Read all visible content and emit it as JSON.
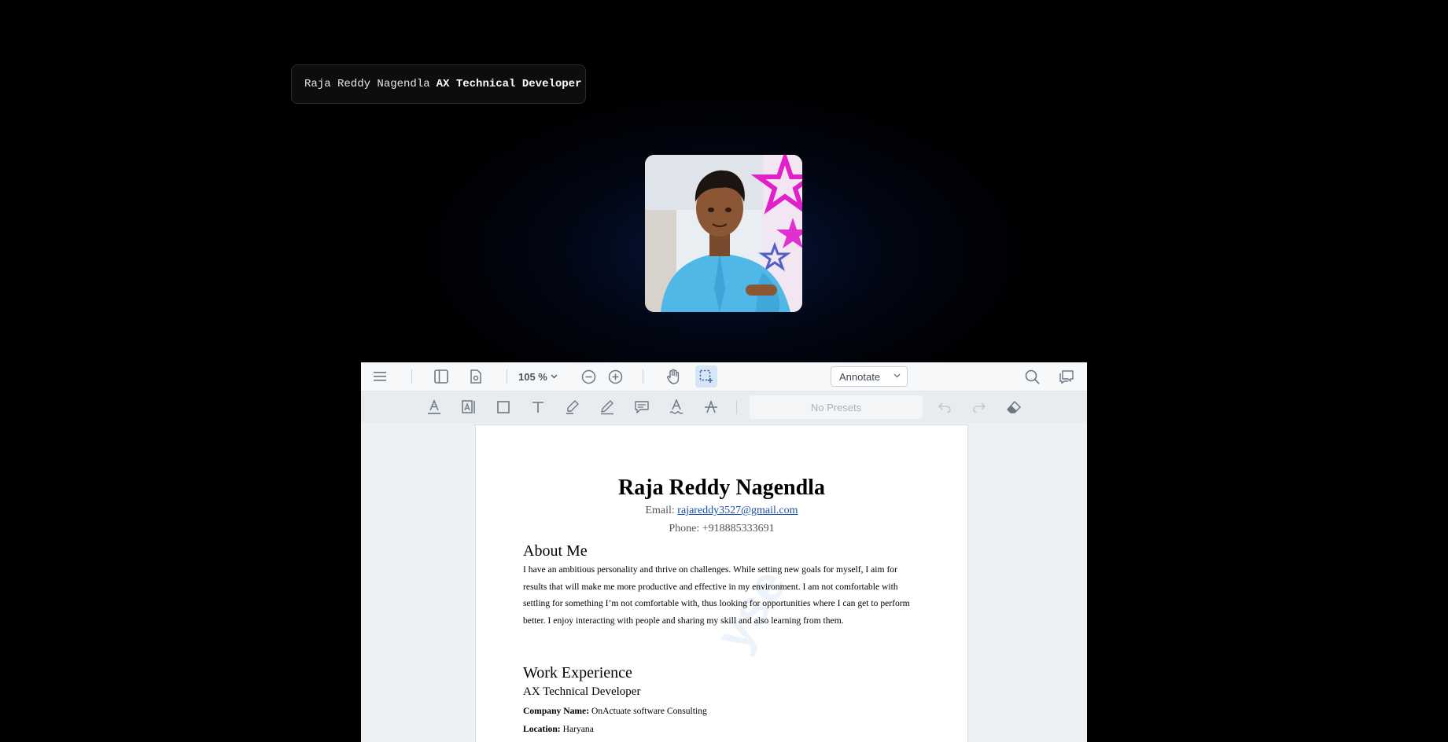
{
  "header": {
    "name": "Raja Reddy Nagendla",
    "role": "AX Technical Developer"
  },
  "avatar": {
    "alt": "Profile photo of Raja Reddy Nagendla"
  },
  "viewer": {
    "toolbar": {
      "menu_icon": "hamburger-menu-icon",
      "zoom": "105 %",
      "mode_select": "Annotate",
      "presets_placeholder": "No Presets"
    },
    "annotation_tools": [
      "text-color-icon",
      "text-highlight-icon",
      "rectangle-icon",
      "text-tool-icon",
      "highlighter-icon",
      "pen-icon",
      "comment-icon",
      "underline-icon",
      "strikethrough-icon"
    ],
    "colors": {
      "accent": "#1a4fa8",
      "active_tool_bg": "#d6e6f7"
    }
  },
  "document": {
    "watermark": "yse",
    "name": "Raja Reddy Nagendla",
    "email_label": "Email:",
    "email": "rajareddy3527@gmail.com",
    "phone": "Phone: +918885333691",
    "about_heading": "About Me",
    "about_text": "I have an ambitious personality and thrive on challenges. While setting new goals for myself, I aim for results that will make me more productive and effective in my environment. I am not comfortable with settling for something I’m not comfortable with, thus looking for opportunities where I can get to perform better. I enjoy interacting with people and sharing my skill and also learning from them.",
    "work_heading": "Work Experience",
    "job_title": "AX Technical Developer",
    "company_label": "Company Name:",
    "company": "OnActuate software Consulting",
    "location_label": "Location:",
    "location": "Haryana"
  }
}
